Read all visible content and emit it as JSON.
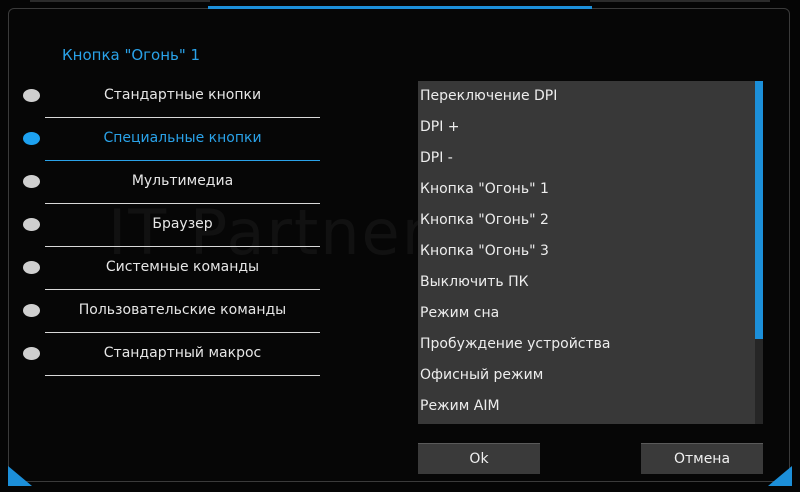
{
  "dialog": {
    "title": "Кнопка \"Огонь\" 1",
    "accent_color": "#1c8fd9"
  },
  "menu": {
    "items": [
      {
        "label": "Стандартные кнопки",
        "active": false
      },
      {
        "label": "Специальные кнопки",
        "active": true
      },
      {
        "label": "Мультимедиа",
        "active": false
      },
      {
        "label": "Браузер",
        "active": false
      },
      {
        "label": "Системные команды",
        "active": false
      },
      {
        "label": "Пользовательские команды",
        "active": false
      },
      {
        "label": "Стандартный макрос",
        "active": false
      }
    ]
  },
  "list": {
    "items": [
      "Переключение DPI",
      "DPI +",
      "DPI -",
      "Кнопка \"Огонь\" 1",
      "Кнопка \"Огонь\" 2",
      "Кнопка \"Огонь\" 3",
      "Выключить ПК",
      "Режим сна",
      "Пробуждение устройства",
      "Офисный режим",
      "Режим AIM"
    ]
  },
  "buttons": {
    "ok_label": "Ok",
    "cancel_label": "Отмена"
  },
  "watermark": {
    "text": "IT Partner"
  }
}
